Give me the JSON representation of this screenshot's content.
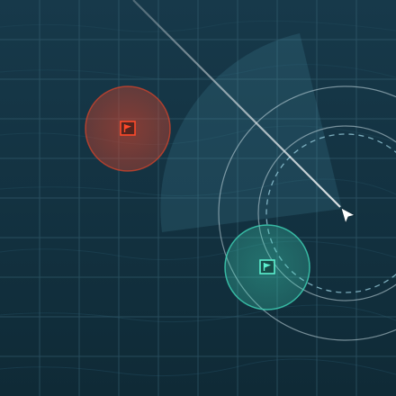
{
  "map": {
    "colors": {
      "water_dark": "#0f2a36",
      "water_mid": "#17394a",
      "grid": "#3a6677",
      "hostile": "#e0442a",
      "friendly": "#3fd6b8",
      "ring": "#c8dde3",
      "ship": "#ffffff"
    },
    "objectives": [
      {
        "name": "hostile-flag",
        "team": "hostile",
        "icon": "flag-icon"
      },
      {
        "name": "friendly-flag",
        "team": "friendly",
        "icon": "flag-icon"
      }
    ],
    "player": {
      "icon": "ship-arrow-icon",
      "heading_deg": 315
    }
  }
}
